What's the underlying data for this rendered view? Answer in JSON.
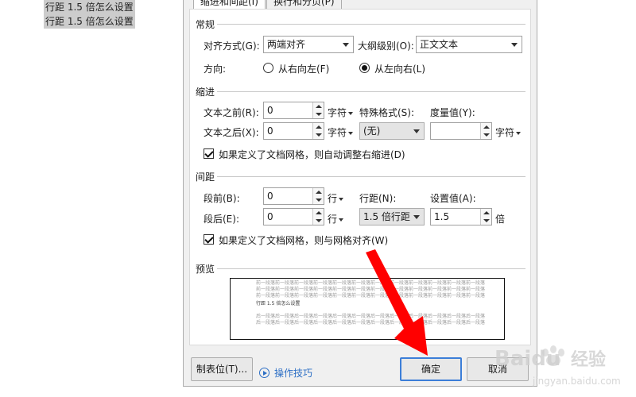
{
  "document": {
    "lines": [
      "行距 1.5 倍怎么设置",
      "行距 1.5 倍怎么设置"
    ]
  },
  "dialog": {
    "tabs": [
      "缩进和间距(I)",
      "换行和分页(P)"
    ],
    "general": {
      "section": "常规",
      "alignment_label": "对齐方式(G):",
      "alignment_value": "两端对齐",
      "outline_label": "大纲级别(O):",
      "outline_value": "正文文本",
      "direction_label": "方向:",
      "rtl_label": "从右向左(F)",
      "ltr_label": "从左向右(L)"
    },
    "indent": {
      "section": "缩进",
      "before_label": "文本之前(R):",
      "before_value": "0",
      "before_unit": "字符",
      "after_label": "文本之后(X):",
      "after_value": "0",
      "after_unit": "字符",
      "special_label": "特殊格式(S):",
      "special_value": "(无)",
      "measure_label": "度量值(Y):",
      "measure_value": "",
      "measure_unit": "字符",
      "grid_checkbox": "如果定义了文档网格，则自动调整右缩进(D)"
    },
    "spacing": {
      "section": "间距",
      "before_label": "段前(B):",
      "before_value": "0",
      "before_unit": "行",
      "after_label": "段后(E):",
      "after_value": "0",
      "after_unit": "行",
      "line_spacing_label": "行距(N):",
      "line_spacing_value": "1.5 倍行距",
      "set_value_label": "设置值(A):",
      "set_value": "1.5",
      "set_value_unit": "倍",
      "grid_checkbox": "如果定义了文档网格，则与网格对齐(W)"
    },
    "preview": {
      "section": "预览",
      "before_lines": [
        "前一段落前一段落前一段落前一段落前一段落前一段落前一段落前一段落前一段落前一段落前一段落前一段落",
        "前一段落前一段落前一段落前一段落前一段落前一段落前一段落前一段落前一段落前一段落前一段落前一段落",
        "前一段落前一段落前一段落前一段落前一段落前一段落前一段落前一段落前一段落前一段落前一段落前一段落"
      ],
      "sample_text": "行距 1.5 倍怎么设置",
      "after_lines": [
        "后一段落后一段落后一段落后一段落后一段落后一段落后一段落后一段落后一段落后一段落后一段落后一段落",
        "后一段落后一段落后一段落后一段落后一段落后一段落后一段落后一段落后一段落后一段落后一段落后一段落"
      ]
    },
    "buttons": {
      "tabs_button": "制表位(T)...",
      "tips": "操作技巧",
      "ok": "确定",
      "cancel": "取消"
    }
  },
  "watermark": {
    "brand": "Baidu",
    "brand_cn": "经验",
    "url": "jingyan.baidu.com"
  },
  "colors": {
    "annotation_arrow": "#ff0000",
    "link": "#2d6fc5",
    "primary_border": "#3c7ed8"
  }
}
